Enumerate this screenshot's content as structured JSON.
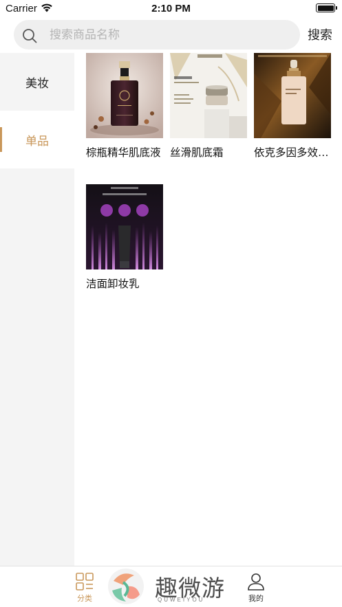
{
  "status_bar": {
    "carrier": "Carrier",
    "time": "2:10 PM"
  },
  "search": {
    "placeholder": "搜索商品名称",
    "button_label": "搜索"
  },
  "sidebar": {
    "items": [
      {
        "label": "美妆",
        "active": false
      },
      {
        "label": "单品",
        "active": true
      }
    ]
  },
  "products": [
    {
      "name": "棕瓶精华肌底液",
      "image": "brown-serum-bottle"
    },
    {
      "name": "丝滑肌底霜",
      "image": "aior-cream-jar"
    },
    {
      "name": "依克多因多效修护精华",
      "image": "pump-serum-bottle"
    },
    {
      "name": "洁面卸妆乳",
      "image": "cleanser-tube"
    }
  ],
  "tab_bar": {
    "tabs": [
      {
        "label": "分类",
        "icon": "grid-icon",
        "active": true
      },
      {
        "label": "我的",
        "icon": "person-icon",
        "active": false
      }
    ],
    "active_color": "#c9975a"
  },
  "watermark": {
    "text": "趣微游",
    "subtext": "QUWEIYOU"
  },
  "colors": {
    "accent": "#c9975a",
    "sidebar_bg": "#f4f4f4",
    "search_bg": "#efefef"
  }
}
